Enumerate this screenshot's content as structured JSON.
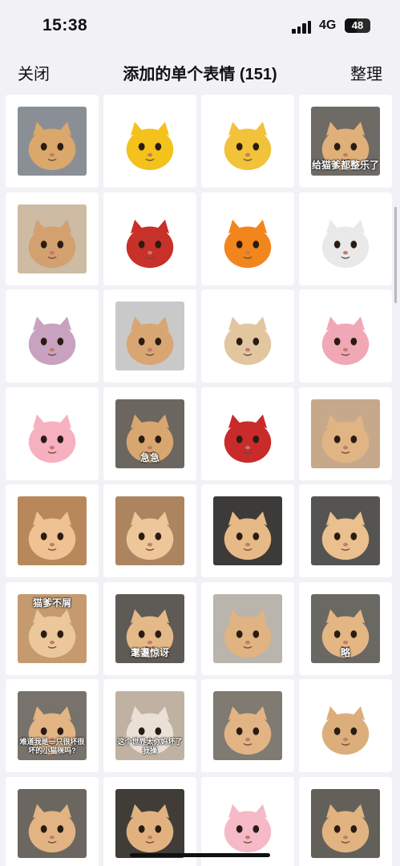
{
  "status": {
    "time": "15:38",
    "network": "4G",
    "battery": "48",
    "battery_fraction": 0.48
  },
  "nav": {
    "close_label": "关闭",
    "title": "添加的单个表情 (151)",
    "organize_label": "整理"
  },
  "stickers": [
    {
      "caption": "",
      "bg": "#8a8f96",
      "accent": "#d9a86a"
    },
    {
      "caption": "",
      "bg": "#ffffff",
      "accent": "#f3c21b"
    },
    {
      "caption": "",
      "bg": "#ffffff",
      "accent": "#f1c23a"
    },
    {
      "caption": "给猫爹都整乐了",
      "bg": "#6e6a66",
      "accent": "#e0b07a"
    },
    {
      "caption": "",
      "bg": "#cdbba3",
      "accent": "#d3a070"
    },
    {
      "caption": "",
      "bg": "#ffffff",
      "accent": "#c8302a"
    },
    {
      "caption": "",
      "bg": "#ffffff",
      "accent": "#f2861c"
    },
    {
      "caption": "",
      "bg": "#ffffff",
      "accent": "#e9e9e9"
    },
    {
      "caption": "",
      "bg": "#ffffff",
      "accent": "#c9a2c0"
    },
    {
      "caption": "",
      "bg": "#c9c9c9",
      "accent": "#d8a672"
    },
    {
      "caption": "",
      "bg": "#ffffff",
      "accent": "#e2c6a0"
    },
    {
      "caption": "",
      "bg": "#ffffff",
      "accent": "#f0a8b6"
    },
    {
      "caption": "",
      "bg": "#ffffff",
      "accent": "#f7b0c0"
    },
    {
      "caption": "急急",
      "bg": "#6b665f",
      "accent": "#d7a76f"
    },
    {
      "caption": "",
      "bg": "#ffffff",
      "accent": "#c92a2a"
    },
    {
      "caption": "",
      "bg": "#c6a98a",
      "accent": "#e0b483"
    },
    {
      "caption": "",
      "bg": "#b9885a",
      "accent": "#eec292"
    },
    {
      "caption": "",
      "bg": "#ad8460",
      "accent": "#edc69a"
    },
    {
      "caption": "",
      "bg": "#3c3b39",
      "accent": "#e6b986"
    },
    {
      "caption": "",
      "bg": "#565452",
      "accent": "#e9c08e"
    },
    {
      "caption": "猫爹不屑",
      "bg": "#c49a6e",
      "accent": "#ecc79c"
    },
    {
      "caption": "耄耋惊讶",
      "bg": "#5e5a55",
      "accent": "#e5b887"
    },
    {
      "caption": "",
      "bg": "#b9b4ac",
      "accent": "#dfb382"
    },
    {
      "caption": "略",
      "bg": "#6a6863",
      "accent": "#e3b684"
    },
    {
      "caption": "难道我是一只很坏很坏的小猫咪吗?",
      "bg": "#77726c",
      "accent": "#e3b584"
    },
    {
      "caption": "这个世界太你妈坏了我操",
      "bg": "#bfb2a2",
      "accent": "#eae0d6"
    },
    {
      "caption": "",
      "bg": "#7f7a72",
      "accent": "#e2b484"
    },
    {
      "caption": "",
      "bg": "#ffffff",
      "accent": "#dcae7c"
    },
    {
      "caption": "",
      "bg": "#6b6760",
      "accent": "#e2b483"
    },
    {
      "caption": "",
      "bg": "#403d39",
      "accent": "#e1b280"
    },
    {
      "caption": "",
      "bg": "#ffffff",
      "accent": "#f5b9c8"
    },
    {
      "caption": "",
      "bg": "#63605a",
      "accent": "#e1b381"
    }
  ]
}
